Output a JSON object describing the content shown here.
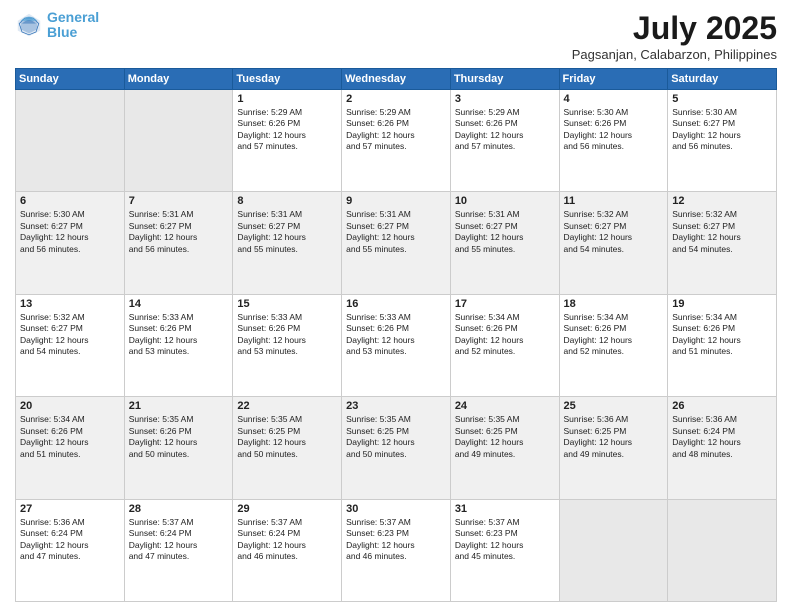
{
  "header": {
    "logo_line1": "General",
    "logo_line2": "Blue",
    "month": "July 2025",
    "location": "Pagsanjan, Calabarzon, Philippines"
  },
  "weekdays": [
    "Sunday",
    "Monday",
    "Tuesday",
    "Wednesday",
    "Thursday",
    "Friday",
    "Saturday"
  ],
  "weeks": [
    [
      {
        "day": "",
        "info": ""
      },
      {
        "day": "",
        "info": ""
      },
      {
        "day": "1",
        "info": "Sunrise: 5:29 AM\nSunset: 6:26 PM\nDaylight: 12 hours\nand 57 minutes."
      },
      {
        "day": "2",
        "info": "Sunrise: 5:29 AM\nSunset: 6:26 PM\nDaylight: 12 hours\nand 57 minutes."
      },
      {
        "day": "3",
        "info": "Sunrise: 5:29 AM\nSunset: 6:26 PM\nDaylight: 12 hours\nand 57 minutes."
      },
      {
        "day": "4",
        "info": "Sunrise: 5:30 AM\nSunset: 6:26 PM\nDaylight: 12 hours\nand 56 minutes."
      },
      {
        "day": "5",
        "info": "Sunrise: 5:30 AM\nSunset: 6:27 PM\nDaylight: 12 hours\nand 56 minutes."
      }
    ],
    [
      {
        "day": "6",
        "info": "Sunrise: 5:30 AM\nSunset: 6:27 PM\nDaylight: 12 hours\nand 56 minutes."
      },
      {
        "day": "7",
        "info": "Sunrise: 5:31 AM\nSunset: 6:27 PM\nDaylight: 12 hours\nand 56 minutes."
      },
      {
        "day": "8",
        "info": "Sunrise: 5:31 AM\nSunset: 6:27 PM\nDaylight: 12 hours\nand 55 minutes."
      },
      {
        "day": "9",
        "info": "Sunrise: 5:31 AM\nSunset: 6:27 PM\nDaylight: 12 hours\nand 55 minutes."
      },
      {
        "day": "10",
        "info": "Sunrise: 5:31 AM\nSunset: 6:27 PM\nDaylight: 12 hours\nand 55 minutes."
      },
      {
        "day": "11",
        "info": "Sunrise: 5:32 AM\nSunset: 6:27 PM\nDaylight: 12 hours\nand 54 minutes."
      },
      {
        "day": "12",
        "info": "Sunrise: 5:32 AM\nSunset: 6:27 PM\nDaylight: 12 hours\nand 54 minutes."
      }
    ],
    [
      {
        "day": "13",
        "info": "Sunrise: 5:32 AM\nSunset: 6:27 PM\nDaylight: 12 hours\nand 54 minutes."
      },
      {
        "day": "14",
        "info": "Sunrise: 5:33 AM\nSunset: 6:26 PM\nDaylight: 12 hours\nand 53 minutes."
      },
      {
        "day": "15",
        "info": "Sunrise: 5:33 AM\nSunset: 6:26 PM\nDaylight: 12 hours\nand 53 minutes."
      },
      {
        "day": "16",
        "info": "Sunrise: 5:33 AM\nSunset: 6:26 PM\nDaylight: 12 hours\nand 53 minutes."
      },
      {
        "day": "17",
        "info": "Sunrise: 5:34 AM\nSunset: 6:26 PM\nDaylight: 12 hours\nand 52 minutes."
      },
      {
        "day": "18",
        "info": "Sunrise: 5:34 AM\nSunset: 6:26 PM\nDaylight: 12 hours\nand 52 minutes."
      },
      {
        "day": "19",
        "info": "Sunrise: 5:34 AM\nSunset: 6:26 PM\nDaylight: 12 hours\nand 51 minutes."
      }
    ],
    [
      {
        "day": "20",
        "info": "Sunrise: 5:34 AM\nSunset: 6:26 PM\nDaylight: 12 hours\nand 51 minutes."
      },
      {
        "day": "21",
        "info": "Sunrise: 5:35 AM\nSunset: 6:26 PM\nDaylight: 12 hours\nand 50 minutes."
      },
      {
        "day": "22",
        "info": "Sunrise: 5:35 AM\nSunset: 6:25 PM\nDaylight: 12 hours\nand 50 minutes."
      },
      {
        "day": "23",
        "info": "Sunrise: 5:35 AM\nSunset: 6:25 PM\nDaylight: 12 hours\nand 50 minutes."
      },
      {
        "day": "24",
        "info": "Sunrise: 5:35 AM\nSunset: 6:25 PM\nDaylight: 12 hours\nand 49 minutes."
      },
      {
        "day": "25",
        "info": "Sunrise: 5:36 AM\nSunset: 6:25 PM\nDaylight: 12 hours\nand 49 minutes."
      },
      {
        "day": "26",
        "info": "Sunrise: 5:36 AM\nSunset: 6:24 PM\nDaylight: 12 hours\nand 48 minutes."
      }
    ],
    [
      {
        "day": "27",
        "info": "Sunrise: 5:36 AM\nSunset: 6:24 PM\nDaylight: 12 hours\nand 47 minutes."
      },
      {
        "day": "28",
        "info": "Sunrise: 5:37 AM\nSunset: 6:24 PM\nDaylight: 12 hours\nand 47 minutes."
      },
      {
        "day": "29",
        "info": "Sunrise: 5:37 AM\nSunset: 6:24 PM\nDaylight: 12 hours\nand 46 minutes."
      },
      {
        "day": "30",
        "info": "Sunrise: 5:37 AM\nSunset: 6:23 PM\nDaylight: 12 hours\nand 46 minutes."
      },
      {
        "day": "31",
        "info": "Sunrise: 5:37 AM\nSunset: 6:23 PM\nDaylight: 12 hours\nand 45 minutes."
      },
      {
        "day": "",
        "info": ""
      },
      {
        "day": "",
        "info": ""
      }
    ]
  ]
}
